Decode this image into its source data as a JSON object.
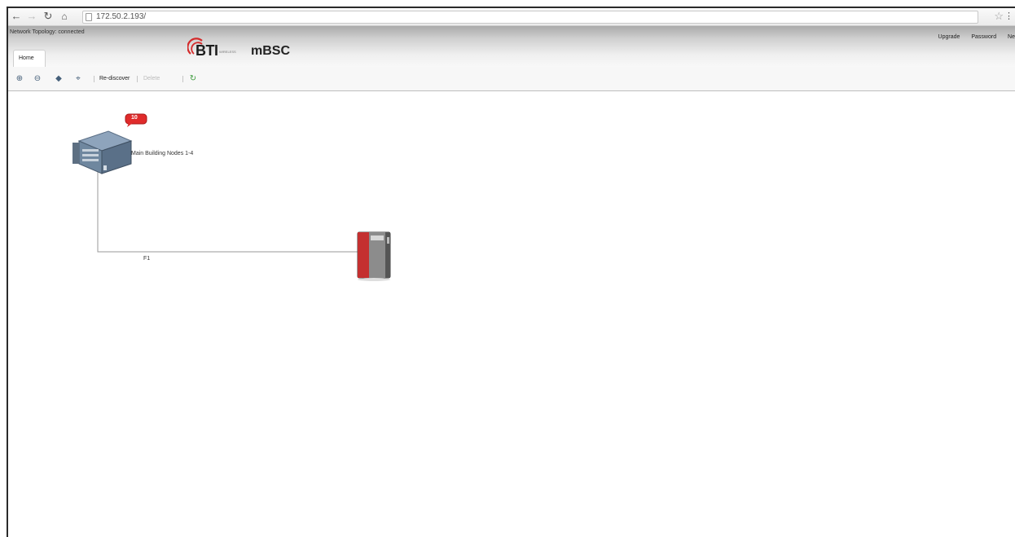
{
  "browser": {
    "url": "172.50.2.193/",
    "back_icon": "back-arrow-icon",
    "forward_icon": "forward-arrow-icon",
    "reload_icon": "reload-icon",
    "home_icon": "home-icon",
    "bookmark_icon": "star-icon"
  },
  "header": {
    "meta_text": "Network Topology: connected",
    "links": [
      "Upgrade",
      "Password",
      "Ne"
    ],
    "tab_home": "Home"
  },
  "logo": {
    "brand": "BTI",
    "brand_sub": "WIRELESS",
    "product": "mBSC",
    "accent_color": "#d42a2a"
  },
  "toolbar": {
    "zoom_in_icon": "zoom-in-icon",
    "zoom_out_icon": "zoom-out-icon",
    "fit_icon": "fit-icon",
    "expand_icon": "expand-icon",
    "rediscover_label": "Re-discover",
    "delete_label": "Delete",
    "refresh_icon": "refresh-icon"
  },
  "topology": {
    "node1_label": "Main Building Nodes 1-4",
    "alarm_badge": "10",
    "alarm_color": "#e02b2b",
    "link_label": "F1"
  }
}
